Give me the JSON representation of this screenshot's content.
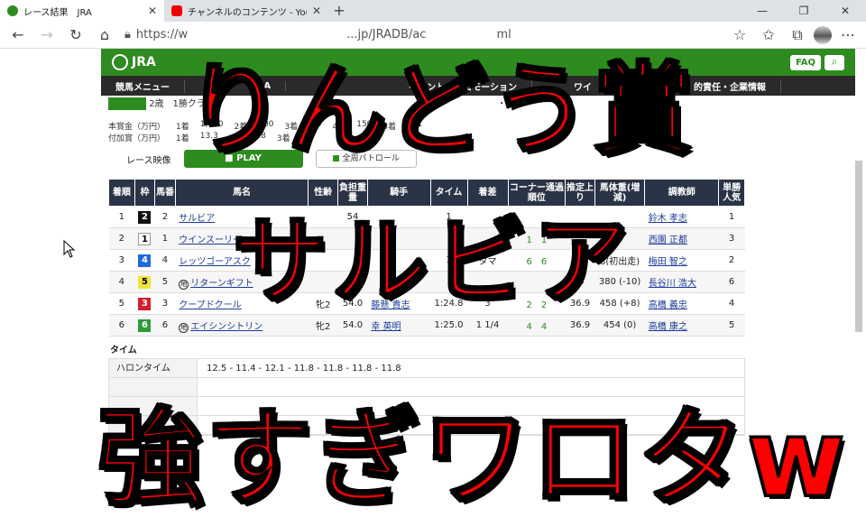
{
  "browser": {
    "tabs": [
      {
        "title": "レース結果　JRA",
        "active": true
      },
      {
        "title": "チャンネルのコンテンツ - YouTube St",
        "active": false
      }
    ],
    "url": "https://www.jra.go.jp/JRADB/ac...ml",
    "url_shown_prefix": "https://w",
    "url_shown_mid": "...jp/JRADB/ac",
    "url_shown_suffix": "ml"
  },
  "site": {
    "logo": "JRA",
    "faq": "FAQ",
    "nav": [
      "競馬メニュー",
      "JRA",
      "イベント・プロモーション",
      "ワイ",
      "的責任・企業情報"
    ]
  },
  "race": {
    "subtitle": "2歳　1勝クラ",
    "course_tail": "・右",
    "prize_main": [
      "本賞金（万円）",
      "1着",
      "1,010",
      "2着",
      "400",
      "3着",
      "2.0",
      "4着",
      "150",
      "5着",
      "101"
    ],
    "prize_add": [
      "付加賞（万円）",
      "1着",
      "13.3",
      "2着",
      "3.8",
      "3着",
      "1.9"
    ]
  },
  "video": {
    "label": "レース映像",
    "play": "PLAY",
    "patrol": "全周パトロール"
  },
  "table": {
    "headers": [
      "着順",
      "枠",
      "馬番",
      "馬名",
      "性齢",
      "負担重量",
      "騎手",
      "タイム",
      "着差",
      "コーナー通過順位",
      "推定上り",
      "馬体重(増減)",
      "調教師",
      "単勝人気"
    ],
    "rows": [
      {
        "rank": "1",
        "waku": "2",
        "num": "2",
        "horse": "サルビア",
        "sex": "",
        "weight": "54",
        "jockey": "",
        "time": "1",
        "margin": "",
        "corner": "",
        "agari": "",
        "body": "",
        "trainer": "鈴木 孝志",
        "pop": "1"
      },
      {
        "rank": "2",
        "waku": "1",
        "num": "1",
        "horse": "ウインスーリー",
        "sex": "",
        "weight": "",
        "jockey": "",
        "time": "",
        "margin": "",
        "corner": "1　1",
        "agari": "",
        "body": "",
        "trainer": "西園 正都",
        "pop": "3"
      },
      {
        "rank": "3",
        "waku": "4",
        "num": "4",
        "horse": "レッツゴーアスク",
        "sex": "",
        "weight": "",
        "jockey": "",
        "time": "1",
        "margin": "タマ",
        "corner": "6　6",
        "agari": "",
        "body": "8(初出走)",
        "trainer": "梅田 智之",
        "pop": "2"
      },
      {
        "rank": "4",
        "waku": "5",
        "num": "5",
        "horse": "リターンギフト",
        "sex": "",
        "weight": "",
        "jockey": "",
        "time": "",
        "margin": "",
        "corner": "",
        "agari": ".5",
        "body": "380 (-10)",
        "trainer": "長谷川 浩大",
        "pop": "6"
      },
      {
        "rank": "5",
        "waku": "3",
        "num": "3",
        "horse": "クープドクール",
        "sex": "牝2",
        "weight": "54.0",
        "jockey": "藤懸 貴志",
        "time": "1:24.8",
        "margin": "3",
        "corner": "2　2",
        "agari": "36.9",
        "body": "458 (+8)",
        "trainer": "高橋 義忠",
        "pop": "4"
      },
      {
        "rank": "6",
        "waku": "6",
        "num": "6",
        "horse": "エイシンシトリン",
        "sex": "牝2",
        "weight": "54.0",
        "jockey": "幸 英明",
        "time": "1:25.0",
        "margin": "1 1/4",
        "corner": "4　4",
        "agari": "36.9",
        "body": "454 (0)",
        "trainer": "高橋 康之",
        "pop": "5"
      }
    ],
    "marked_rows": [
      3,
      5
    ]
  },
  "time_section": {
    "title": "タイム",
    "rows": [
      {
        "key": "ハロンタイム",
        "value": "12.5 - 11.4 - 12.1 - 11.8 - 11.8 - 11.8 - 11.8"
      },
      {
        "key": "",
        "value": ""
      },
      {
        "key": "",
        "value": ""
      },
      {
        "key": "",
        "value": "-4"
      }
    ]
  },
  "overlay": {
    "line1": "りんどう賞",
    "line2": "サルビア",
    "line3": "強すぎワロタw"
  },
  "colors": {
    "jra_green": "#2e8b1f",
    "header_navy": "#2b3446",
    "overlay_red": "#ff0000"
  }
}
